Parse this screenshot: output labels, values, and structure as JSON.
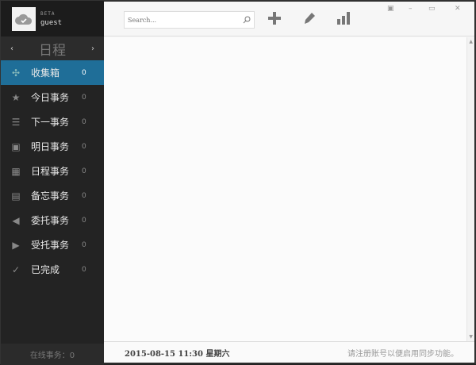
{
  "profile": {
    "badge": "BETA",
    "username": "guest"
  },
  "nav": {
    "title": "日程",
    "prev": "‹",
    "next": "›"
  },
  "sidebar": {
    "items": [
      {
        "label": "收集箱",
        "count": "0",
        "icon": "puzzle-icon",
        "glyph": "✣"
      },
      {
        "label": "今日事务",
        "count": "0",
        "icon": "star-icon",
        "glyph": "★"
      },
      {
        "label": "下一事务",
        "count": "0",
        "icon": "list-icon",
        "glyph": "☰"
      },
      {
        "label": "明日事务",
        "count": "0",
        "icon": "calendar-next-icon",
        "glyph": "▣"
      },
      {
        "label": "日程事务",
        "count": "0",
        "icon": "calendar-icon",
        "glyph": "▦"
      },
      {
        "label": "备忘事务",
        "count": "0",
        "icon": "memo-icon",
        "glyph": "▤"
      },
      {
        "label": "委托事务",
        "count": "0",
        "icon": "send-icon",
        "glyph": "◀"
      },
      {
        "label": "受托事务",
        "count": "0",
        "icon": "receive-icon",
        "glyph": "▶"
      },
      {
        "label": "已完成",
        "count": "0",
        "icon": "check-icon",
        "glyph": "✓"
      }
    ],
    "footer": "在线事务：0"
  },
  "toolbar": {
    "search_placeholder": "Search..."
  },
  "footer": {
    "datetime": "2015-08-15 11:30 星期六",
    "register": "请注册账号以便启用同步功能。"
  }
}
